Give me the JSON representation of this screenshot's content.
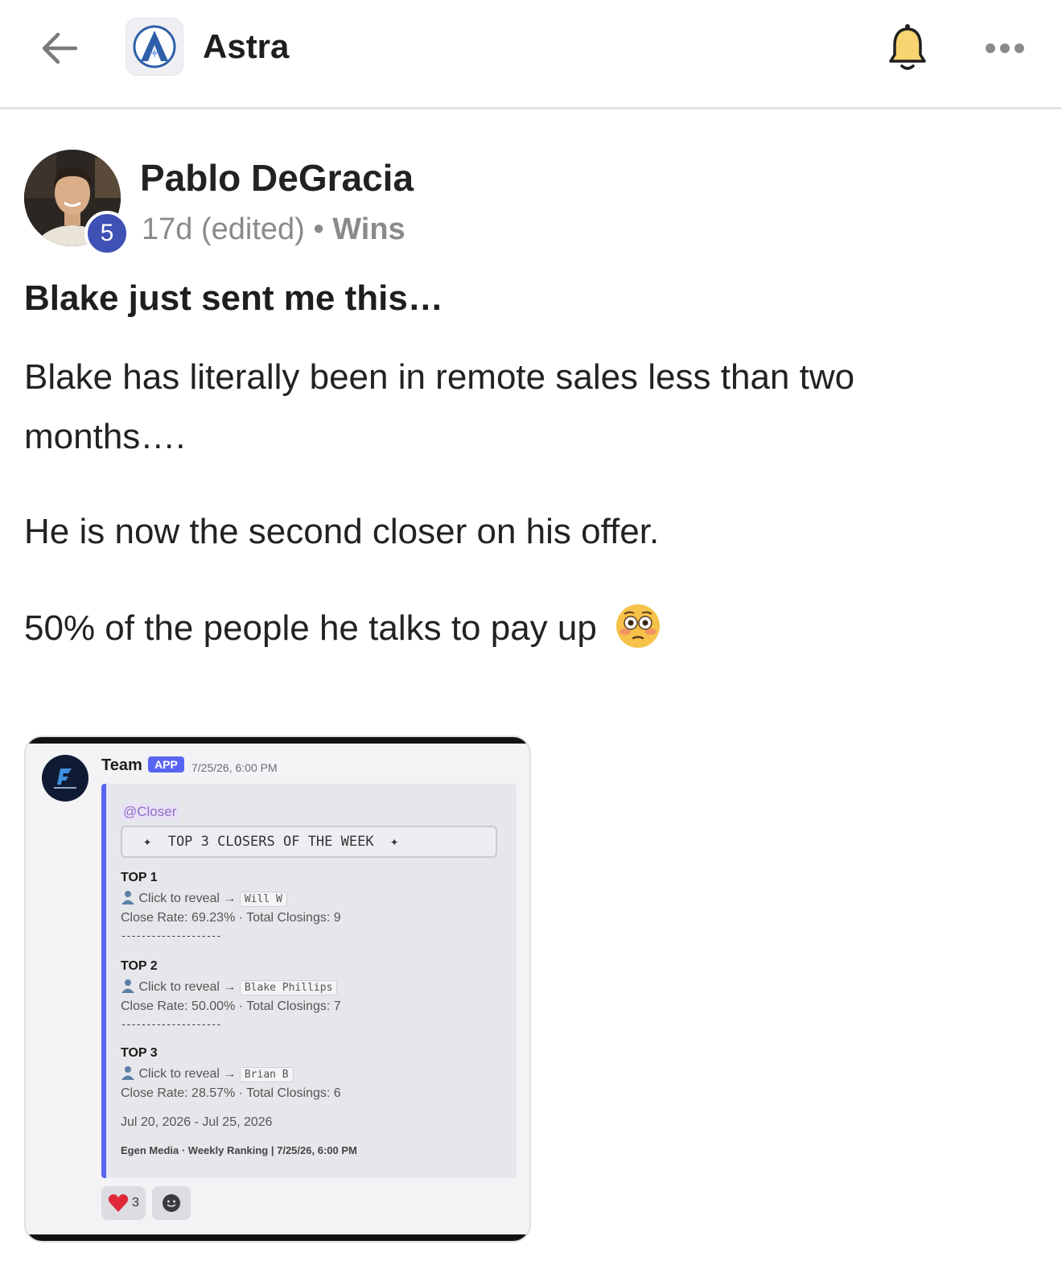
{
  "header": {
    "app_name": "Astra",
    "icons": {
      "back": "arrow-left-icon",
      "logo": "astra-logo",
      "bell": "bell-icon",
      "more": "more-horizontal-icon"
    }
  },
  "post": {
    "author": {
      "name": "Pablo DeGracia",
      "level": "5"
    },
    "age": "17d (edited)",
    "separator": "•",
    "category": "Wins",
    "title": "Blake just sent me this…",
    "paragraphs": [
      "Blake has literally been in remote sales less than two months….",
      "He is now the second closer on his offer.",
      "50% of the people he talks to pay up"
    ],
    "emoji": "flushed-face-emoji"
  },
  "attachment": {
    "sender": "Team",
    "app_tag": "APP",
    "timestamp": "7/25/26, 6:00 PM",
    "mention": "@Closer",
    "banner": "✦  TOP 3 CLOSERS OF THE WEEK  ✦",
    "reveal_text": "Click to reveal",
    "arrow": "→",
    "divider": "--------------------",
    "rankings": [
      {
        "label": "TOP 1",
        "name": "Will W",
        "close_rate": "Close Rate: 69.23%",
        "closings": "Total Closings: 9"
      },
      {
        "label": "TOP 2",
        "name": "Blake Phillips",
        "close_rate": "Close Rate: 50.00%",
        "closings": "Total Closings: 7"
      },
      {
        "label": "TOP 3",
        "name": "Brian B",
        "close_rate": "Close Rate: 28.57%",
        "closings": "Total Closings: 6"
      }
    ],
    "date_range": "Jul 20, 2026 - Jul 25, 2026",
    "footer": "Egen Media · Weekly Ranking | 7/25/26, 6:00 PM",
    "reactions": [
      {
        "icon": "heart-icon",
        "count": "3"
      },
      {
        "icon": "add-reaction-icon",
        "count": ""
      }
    ]
  }
}
